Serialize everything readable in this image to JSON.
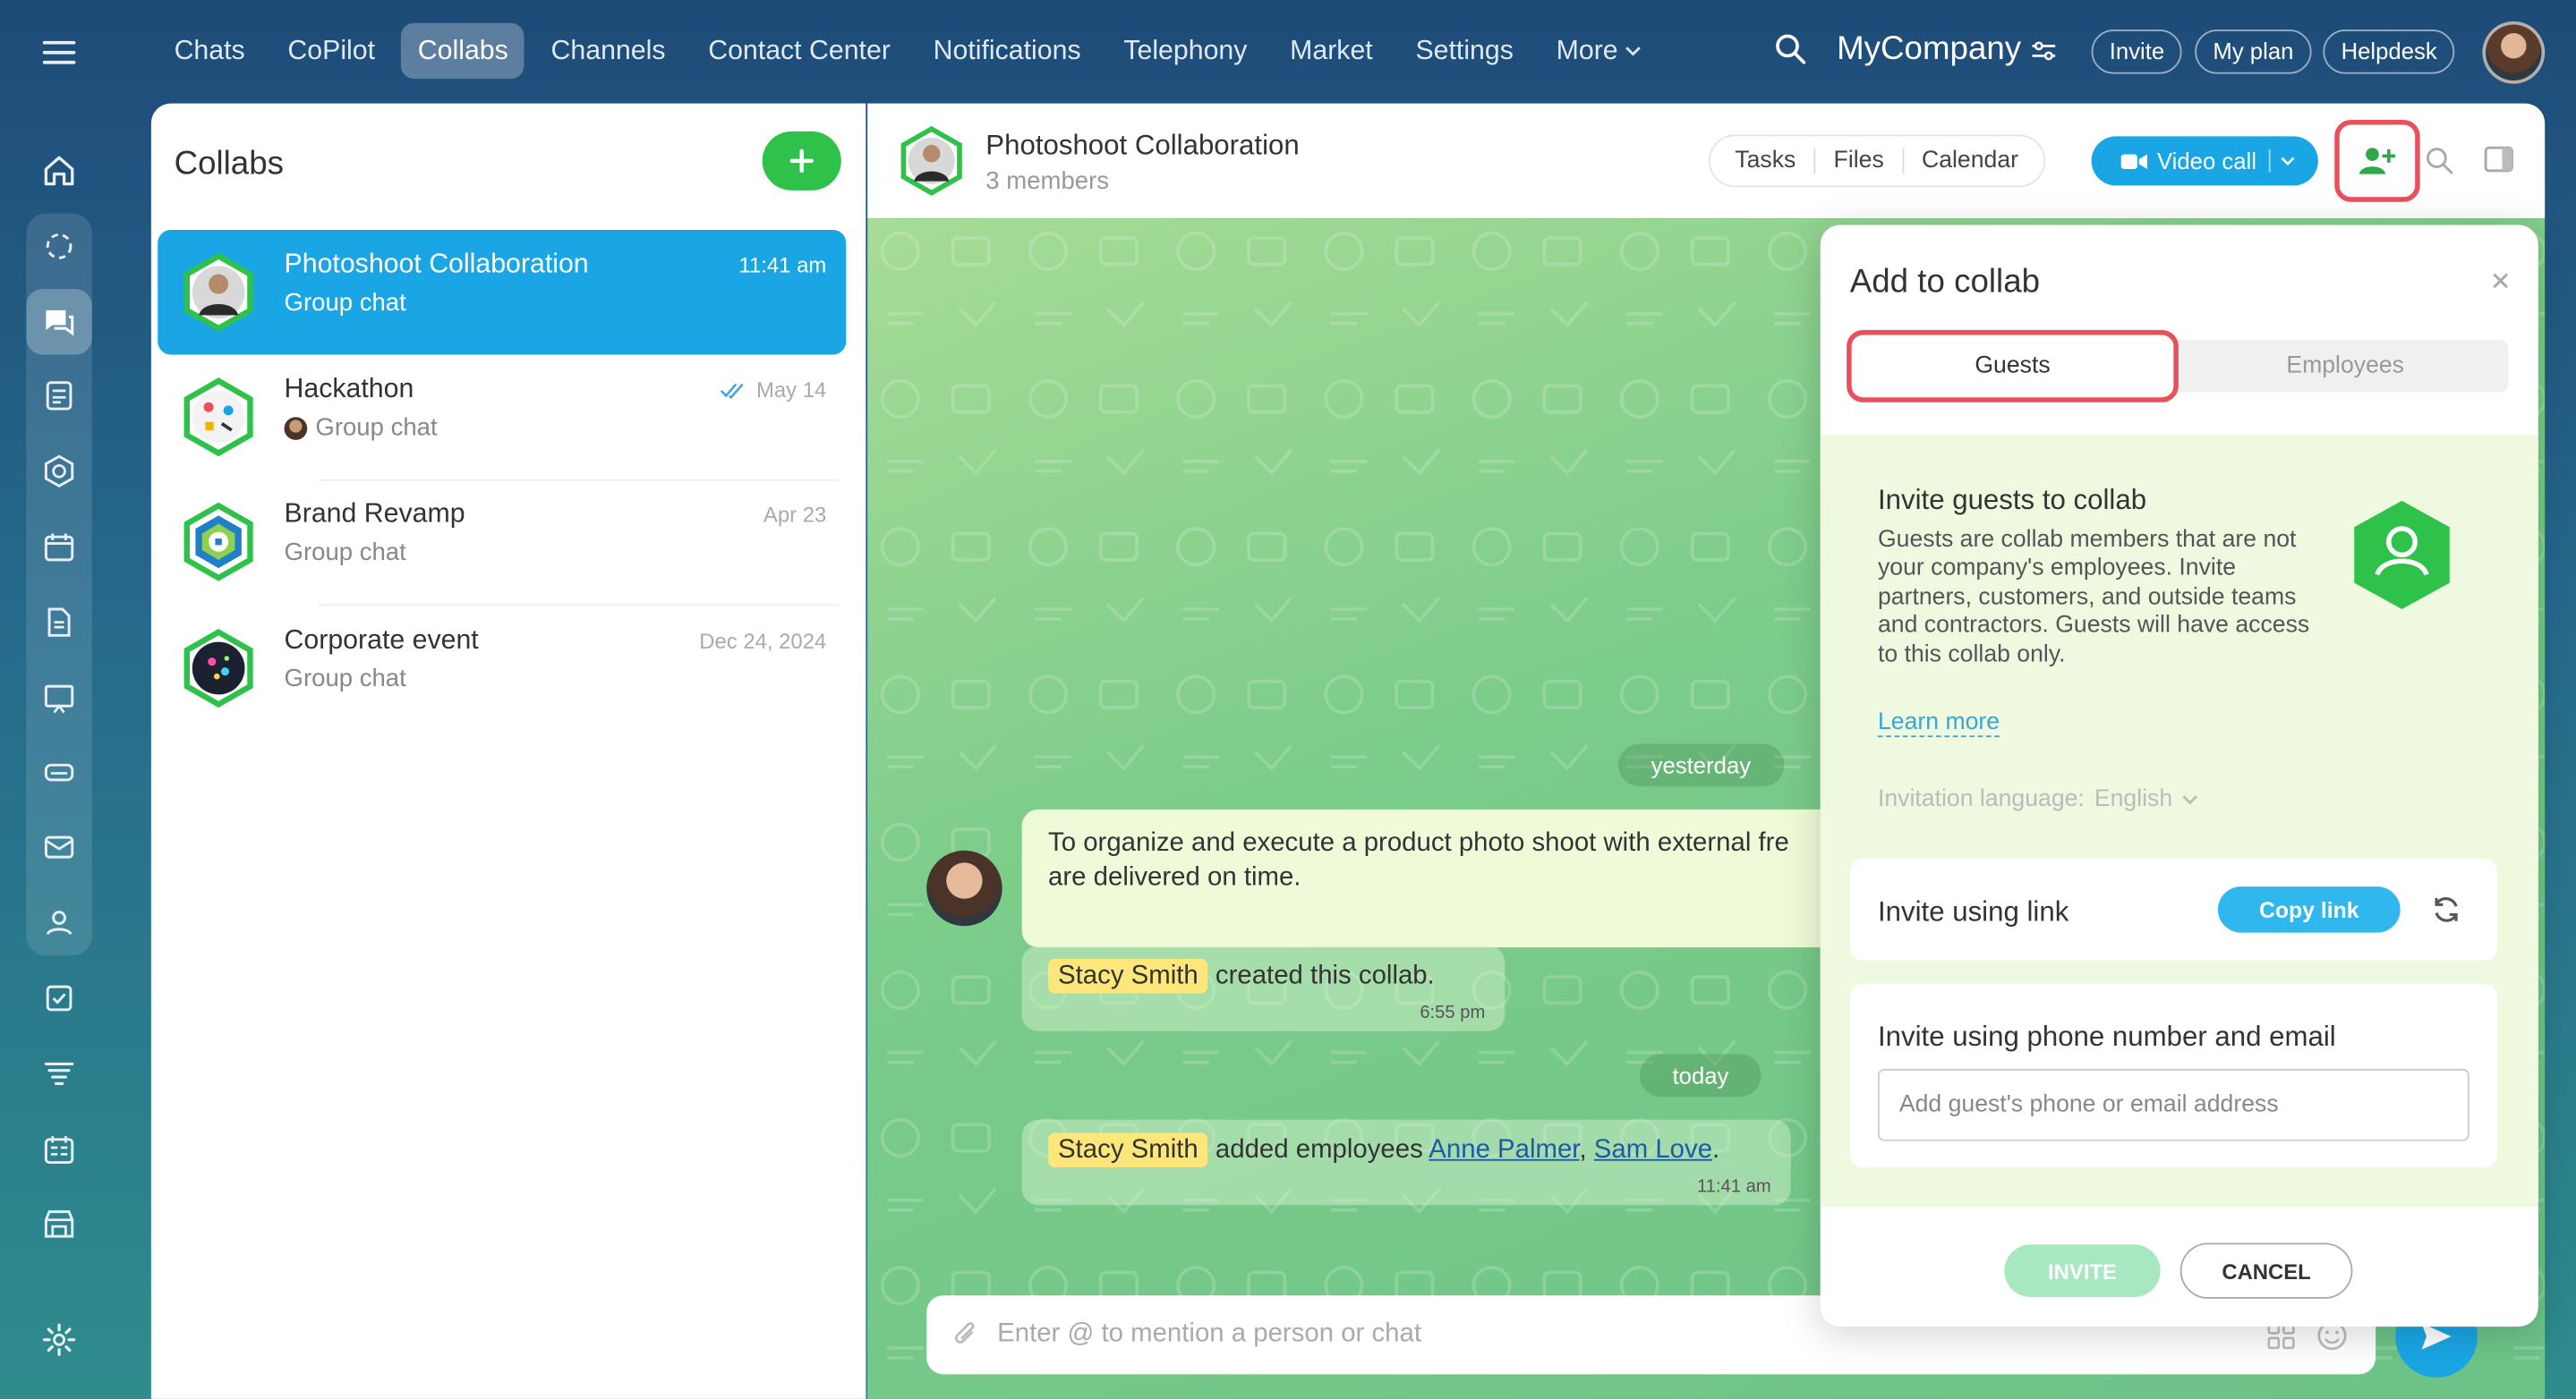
{
  "topnav": {
    "items": [
      "Chats",
      "CoPilot",
      "Collabs",
      "Channels",
      "Contact Center",
      "Notifications",
      "Telephony",
      "Market",
      "Settings"
    ],
    "more_label": "More",
    "company": "MyCompany",
    "invite_label": "Invite",
    "myplan_label": "My plan",
    "helpdesk_label": "Helpdesk"
  },
  "sidebar": {
    "icons": [
      "menu-icon",
      "home-icon",
      "copilot-icon",
      "collabs-icon",
      "feed-icon",
      "groups-icon",
      "calendar-icon",
      "docs-icon",
      "board-icon",
      "drive-icon",
      "mail-icon",
      "contacts-icon",
      "tasks-icon",
      "filter-icon",
      "planner-icon",
      "store-icon",
      "settings-icon"
    ]
  },
  "left_panel": {
    "title": "Collabs",
    "chats": [
      {
        "name": "Photoshoot Collaboration",
        "sub": "Group chat",
        "time": "11:41 am"
      },
      {
        "name": "Hackathon",
        "sub": "Group chat",
        "time": "May 14"
      },
      {
        "name": "Brand Revamp",
        "sub": "Group chat",
        "time": "Apr 23"
      },
      {
        "name": "Corporate event",
        "sub": "Group chat",
        "time": "Dec 24, 2024"
      }
    ]
  },
  "chat_header": {
    "title": "Photoshoot Collaboration",
    "members": "3 members",
    "tabs": [
      "Tasks",
      "Files",
      "Calendar"
    ],
    "video_call_label": "Video call"
  },
  "chat": {
    "date_yesterday": "yesterday",
    "date_today": "today",
    "message_line1": "To organize and execute a product photo shoot with external fre",
    "message_line2": "are delivered on time.",
    "sys1": {
      "name": "Stacy Smith",
      "text": "created this collab.",
      "time": "6:55 pm"
    },
    "sys2": {
      "name": "Stacy Smith",
      "text": "added employees",
      "link1": "Anne Palmer",
      "comma": ",",
      "link2": "Sam Love",
      "dot": ".",
      "time": "11:41 am"
    },
    "composer_placeholder": "Enter @ to mention a person or chat"
  },
  "popup": {
    "title": "Add to collab",
    "tab_guests": "Guests",
    "tab_employees": "Employees",
    "invite_title": "Invite guests to collab",
    "invite_desc": "Guests are collab members that are not your company's employees. Invite partners, customers, and outside teams and contractors. Guests will have access to this collab only.",
    "learn_more": "Learn more",
    "lang_label": "Invitation language:",
    "lang_value": "English",
    "link_label": "Invite using link",
    "copy_link": "Copy link",
    "phone_label": "Invite using phone number and email",
    "phone_placeholder": "Add guest's phone or email address",
    "invite_btn": "INVITE",
    "cancel_btn": "CANCEL"
  },
  "colors": {
    "accent": "#1aa6e4",
    "green": "#2fc24a",
    "highlight": "#e8505b"
  }
}
